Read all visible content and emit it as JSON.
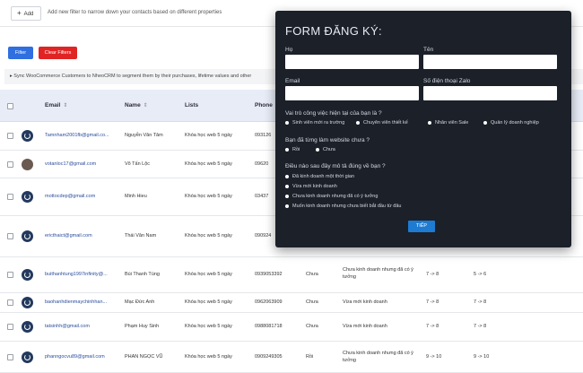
{
  "toolbar": {
    "add_label": "Add",
    "hint": "Add new filter to narrow down your contacts based on different properties"
  },
  "filters": {
    "filter_label": "Filter",
    "clear_label": "Clear Filters"
  },
  "sync_notice": "Sync WooCommerce Customers to NheoCRM to segment them by their purchases, lifetime values and other",
  "table": {
    "headers": [
      "Email",
      "Name",
      "Lists",
      "Phone"
    ],
    "rows": [
      {
        "email": "Tamnham2001fb@gmail.co...",
        "name": "Nguyễn Văn Tâm",
        "list": "Khóa học web 5 ngày",
        "phone": "093126",
        "c5": "",
        "c6": "",
        "c7": "",
        "c8": ""
      },
      {
        "email": "votanloc17@gmail.com",
        "name": "Võ Tấn Lộc",
        "list": "Khóa học web 5 ngày",
        "phone": "09620",
        "c5": "",
        "c6": "",
        "c7": "",
        "c8": ""
      },
      {
        "email": "mottocdep@gmail.com",
        "name": "Minh Hieu",
        "list": "Khóa học web 5 ngày",
        "phone": "03437",
        "c5": "",
        "c6": "",
        "c7": "",
        "c8": ""
      },
      {
        "email": "ericthaict@gmail.com",
        "name": "Thái Văn Nam",
        "list": "Khóa học web 5 ngày",
        "phone": "090924",
        "c5": "",
        "c6": "",
        "c7": "",
        "c8": ""
      },
      {
        "email": "buithanhtung1997infinity@...",
        "name": "Bùi Thanh Tùng",
        "list": "Khóa học web 5 ngày",
        "phone": "0939053392",
        "c5": "Chưa",
        "c6": "Chưa kinh doanh nhưng đã có ý tưởng",
        "c7": "7 -> 8",
        "c8": "5 -> 6"
      },
      {
        "email": "baohanhdienmaychinhhan...",
        "name": "Mạc Đức Anh",
        "list": "Khóa học web 5 ngày",
        "phone": "0962063909",
        "c5": "Chưa",
        "c6": "Vừa mới kinh doanh",
        "c7": "7 -> 8",
        "c8": "7 -> 8"
      },
      {
        "email": "tatsinhh@gmail.com",
        "name": "Phạm Huy Sinh",
        "list": "Khóa học web 5 ngày",
        "phone": "0988081718",
        "c5": "Chưa",
        "c6": "Vừa mới kinh doanh",
        "c7": "7 -> 8",
        "c8": "7 -> 8"
      },
      {
        "email": "phanngocvu89@gmail.com",
        "name": "PHAN NGỌC VŨ",
        "list": "Khóa học web 5 ngày",
        "phone": "0909249305",
        "c5": "Rồi",
        "c6": "Chưa kinh doanh nhưng đã có ý tưởng",
        "c7": "9 -> 10",
        "c8": "9 -> 10"
      }
    ]
  },
  "form": {
    "title": "FORM ĐĂNG KÝ:",
    "ho": "Họ",
    "ten": "Tên",
    "email": "Email",
    "phone": "Số điện thoại Zalo",
    "q1": "Vai trò công việc hiện tại của bạn là ?",
    "q1_opts": [
      "Sinh viên mới ra trường",
      "Chuyên viên thiết kế",
      "Nhân viên Sale",
      "Quản lý doanh nghiệp"
    ],
    "q2": "Bạn đã từng làm website chưa ?",
    "q2_opts": [
      "Rồi",
      "Chưa"
    ],
    "q3": "Điều nào sau đây mô tả đúng về bạn ?",
    "q3_opts": [
      "Đã kinh doanh một thời gian",
      "Vừa mới kinh doanh",
      "Chưa kinh doanh nhưng đã có ý tưởng",
      "Muốn kinh doanh nhưng chưa biết bắt đầu từ đâu"
    ],
    "submit": "TIẾP"
  },
  "colors": {
    "primary": "#2f6fe0",
    "danger": "#e02424",
    "modal_bg": "#1b2029",
    "header_bg": "#e8ecf6"
  }
}
